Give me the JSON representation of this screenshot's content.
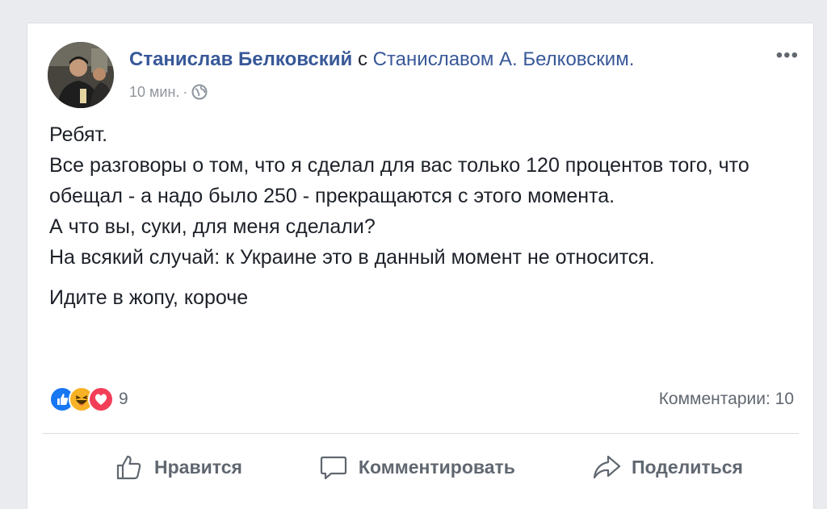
{
  "post": {
    "author": "Станислав Белковский",
    "with_word": "с",
    "tagged": "Станиславом А. Белковским.",
    "time": "10 мин.",
    "meta_separator": "·",
    "more_label": "•••",
    "privacy_icon": "globe-icon",
    "paragraphs": [
      "Ребят.",
      "Все разговоры о том, что я сделал для вас только 120 процентов того, что обещал - а надо было 250 - прекращаются с этого момента.",
      "А что вы, суки, для меня сделали?",
      "На всякий случай: к Украине это в данный момент не относится."
    ],
    "closing": "Идите в жопу, короче"
  },
  "stats": {
    "reaction_icons": [
      "like-icon",
      "haha-icon",
      "love-icon"
    ],
    "reaction_count": "9",
    "comments": "Комментарии: 10"
  },
  "actions": {
    "like": "Нравится",
    "comment": "Комментировать",
    "share": "Поделиться"
  },
  "colors": {
    "link": "#385898",
    "text": "#1d2129",
    "muted": "#606770",
    "like": "#1877f2",
    "haha": "#f7b125",
    "love": "#f33e58"
  }
}
